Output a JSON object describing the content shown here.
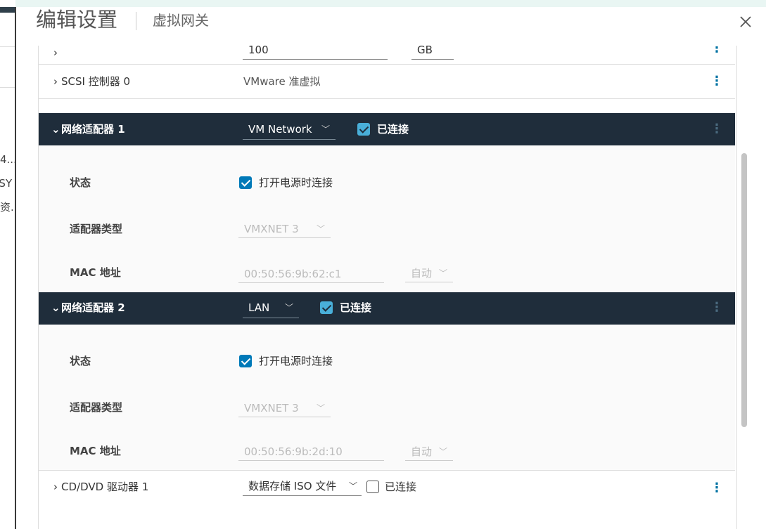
{
  "background_fragments": [
    "4...",
    "JSY",
    "资..."
  ],
  "dialog": {
    "title": "编辑设置",
    "subtitle": "虚拟网关",
    "close_icon": "close-icon"
  },
  "top_row": {
    "input_value": "100",
    "unit_value": "GB"
  },
  "scsi_row": {
    "label": "SCSI 控制器 0",
    "value": "VMware 准虚拟"
  },
  "net1": {
    "label": "网络适配器 1",
    "network_value": "VM Network",
    "connected_label": "已连接",
    "status_label": "状态",
    "power_on_label": "打开电源时连接",
    "adapter_type_label": "适配器类型",
    "adapter_type_value": "VMXNET 3",
    "mac_label": "MAC 地址",
    "mac_value": "00:50:56:9b:62:c1",
    "mac_mode": "自动"
  },
  "net2": {
    "label": "网络适配器 2",
    "network_value": "LAN",
    "connected_label": "已连接",
    "status_label": "状态",
    "power_on_label": "打开电源时连接",
    "adapter_type_label": "适配器类型",
    "adapter_type_value": "VMXNET 3",
    "mac_label": "MAC 地址",
    "mac_value": "00:50:56:9b:2d:10",
    "mac_mode": "自动"
  },
  "cd_row": {
    "label": "CD/DVD 驱动器 1",
    "source_value": "数据存储 ISO 文件",
    "connected_label": "已连接"
  },
  "colors": {
    "dark_header": "#1f2d3b",
    "accent": "#0079b8",
    "link": "#0072a3"
  }
}
